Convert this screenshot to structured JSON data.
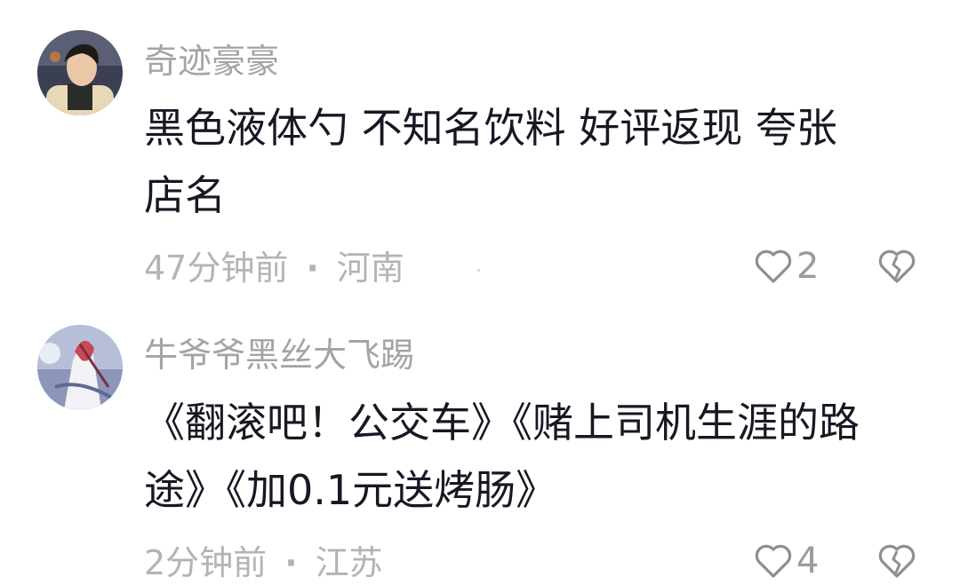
{
  "comments": [
    {
      "username": "奇迹豪豪",
      "lines": [
        "黑色液体勺 不知名饮料 好评返现 夸张",
        "店名"
      ],
      "time": "47分钟前",
      "separator": "·",
      "location": "河南",
      "likes": "2",
      "avatar_icon": "user-avatar-photo",
      "like_icon": "heart-outline-icon",
      "dislike_icon": "broken-heart-icon"
    },
    {
      "username": "牛爷爷黑丝大飞踢",
      "lines": [
        "《翻滚吧！公交车》《赌上司机生涯的路",
        "途》《加0.1元送烤肠》"
      ],
      "time": "2分钟前",
      "separator": "·",
      "location": "江苏",
      "likes": "4",
      "avatar_icon": "anime-avatar-image",
      "like_icon": "heart-outline-icon",
      "dislike_icon": "broken-heart-icon"
    }
  ],
  "colors": {
    "username": "#a3a3a8",
    "body": "#161823",
    "meta": "#b3b3b8",
    "icon": "#8e8e94"
  }
}
